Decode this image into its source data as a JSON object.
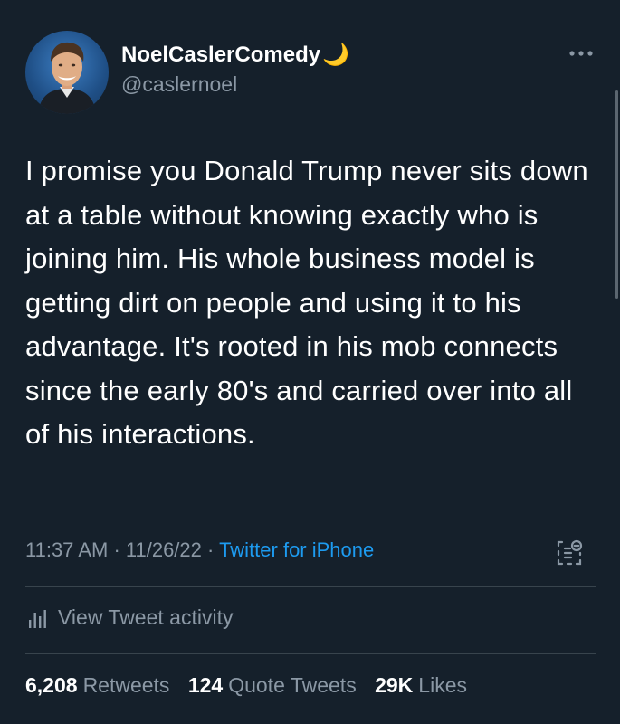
{
  "user": {
    "display_name": "NoelCaslerComedy",
    "moon_emoji": "🌙",
    "handle": "@caslernoel"
  },
  "tweet": {
    "text": "I promise you Donald Trump never sits down at a table without knowing exactly who is joining him. His whole business model is getting dirt on people and using it to his advantage. It's rooted in his mob connects since the early 80's and carried over into all of his interactions.",
    "time": "11:37 AM",
    "separator": " · ",
    "date": "11/26/22",
    "source": "Twitter for iPhone"
  },
  "activity": {
    "label": "View Tweet activity"
  },
  "stats": {
    "retweets_count": "6,208",
    "retweets_label": "Retweets",
    "quotes_count": "124",
    "quotes_label": "Quote Tweets",
    "likes_count": "29K",
    "likes_label": "Likes"
  },
  "colors": {
    "background": "#15202b",
    "text": "#ffffff",
    "secondary": "#8b98a5",
    "link": "#1d9bf0",
    "divider": "#38444d"
  }
}
